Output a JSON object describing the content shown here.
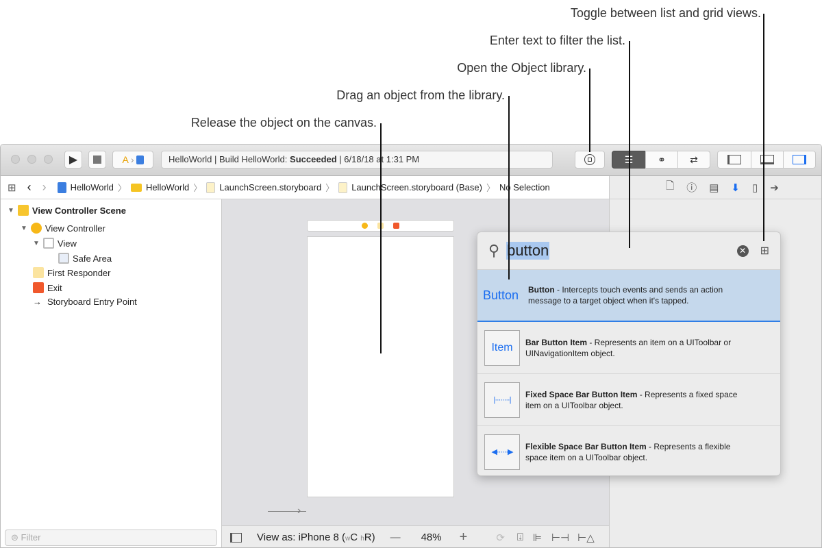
{
  "callouts": {
    "release": "Release the object on the canvas.",
    "drag": "Drag an object from the library.",
    "open": "Open the Object library.",
    "filter": "Enter text to filter the list.",
    "toggle": "Toggle between list and grid views."
  },
  "toolbar": {
    "status_prefix": "HelloWorld | Build HelloWorld: ",
    "status_bold": "Succeeded",
    "status_suffix": " | 6/18/18 at 1:31 PM"
  },
  "jumpbar": [
    "HelloWorld",
    "HelloWorld",
    "LaunchScreen.storyboard",
    "LaunchScreen.storyboard (Base)",
    "No Selection"
  ],
  "outline": {
    "scene": "View Controller Scene",
    "vc": "View Controller",
    "view": "View",
    "safe": "Safe Area",
    "responder": "First Responder",
    "exit": "Exit",
    "entry": "Storyboard Entry Point"
  },
  "filter_placeholder": "Filter",
  "canvas_bar": {
    "view_as": "View as: iPhone 8 (",
    "w": "w",
    "c": "C ",
    "h": "h",
    "r": "R)",
    "zoom": "48%",
    "minus": "—",
    "plus": "+"
  },
  "library": {
    "search": "button",
    "items": [
      {
        "thumb": "Button",
        "name": "Button",
        "desc": " - Intercepts touch events and sends an action message to a target object when it's tapped."
      },
      {
        "thumb": "Item",
        "name": "Bar Button Item",
        "desc": " - Represents an item on a UIToolbar or UINavigationItem object."
      },
      {
        "thumb": "",
        "name": "Fixed Space Bar Button Item",
        "desc": " - Represents a fixed space item on a UIToolbar object."
      },
      {
        "thumb": "",
        "name": "Flexible Space Bar Button Item",
        "desc": " - Represents a flexible space item on a UIToolbar object."
      }
    ]
  },
  "colors": {
    "accent": "#1a6df0",
    "selection": "#c5d8ec"
  }
}
